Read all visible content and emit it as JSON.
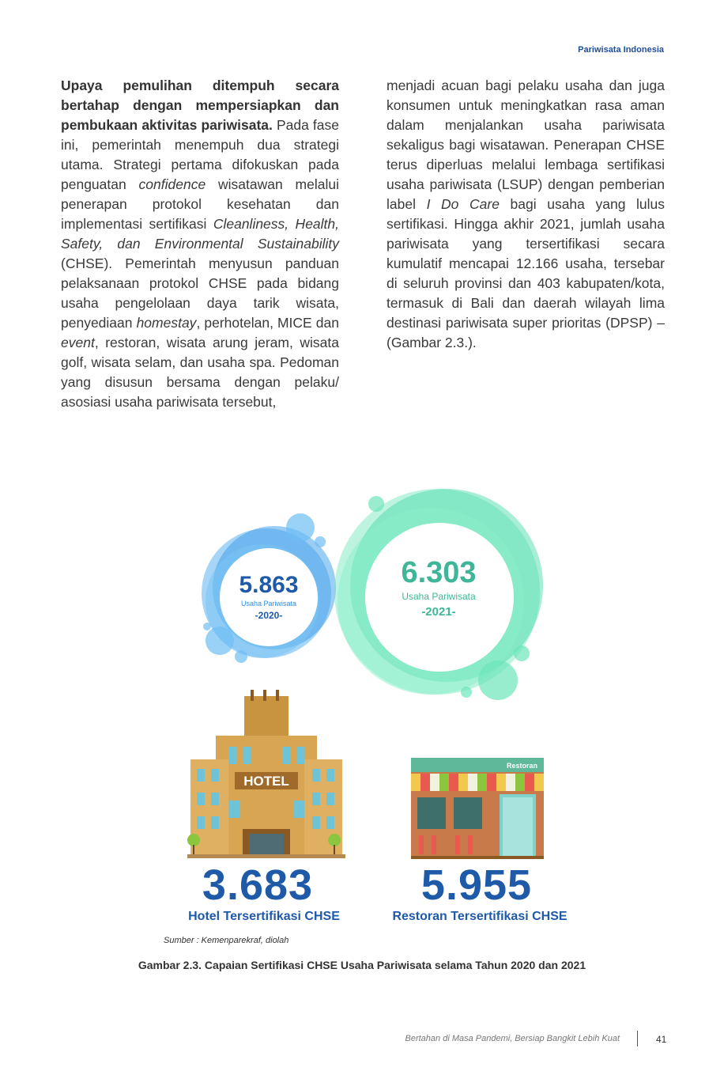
{
  "header": {
    "title": "Pariwisata Indonesia"
  },
  "body": {
    "left": {
      "bold_intro": "Upaya pemulihan ditempuh secara bertahap dengan mempersiapkan dan pembukaan aktivitas pariwisata.",
      "p1": " Pada fase ini, pemerintah menempuh dua strategi utama. Strategi pertama difokuskan pada penguatan ",
      "em_confidence": "confidence",
      "p2": " wisatawan melalui penerapan protokol kesehatan dan implementasi sertifikasi ",
      "em_chse": "Cleanliness, Health, Safety, dan Environmental Sustainability",
      "p3": " (CHSE). Pemerintah menyusun panduan pelaksanaan protokol CHSE pada bidang usaha pengelolaan daya tarik wisata, penyediaan ",
      "em_homestay": "homestay",
      "p4": ", perhotelan, MICE dan ",
      "em_event": "event",
      "p5": ", restoran, wisata arung jeram, wisata golf, wisata selam, dan usaha spa. Pedoman yang disusun bersama dengan pelaku/ asosiasi usaha pariwisata tersebut,"
    },
    "right": {
      "p1": "menjadi acuan bagi pelaku usaha dan juga konsumen untuk meningkatkan rasa aman dalam menjalankan usaha pariwisata sekaligus bagi wisatawan. Penerapan CHSE terus diperluas melalui lembaga sertifikasi usaha pariwisata (LSUP) dengan pemberian label ",
      "em_idocare": "I Do Care",
      "p2": " bagi usaha yang lulus sertifikasi. Hingga akhir 2021, jumlah usaha pariwisata yang tersertifikasi secara kumulatif mencapai 12.166 usaha, tersebar di seluruh provinsi dan 403 kabupaten/kota, termasuk di Bali dan daerah wilayah lima destinasi pariwisata super prioritas (DPSP) – (Gambar 2.3.)."
    }
  },
  "figure": {
    "bubble_2020": {
      "value": "5.863",
      "label": "Usaha Pariwisata",
      "year": "-2020-",
      "color": "#2e8fe0"
    },
    "bubble_2021": {
      "value": "6.303",
      "label": "Usaha Pariwisata",
      "year": "-2021-",
      "color": "#3fd6a4"
    },
    "hotel": {
      "sign": "HOTEL",
      "value": "3.683",
      "caption": "Hotel Tersertifikasi CHSE"
    },
    "restaurant": {
      "sign": "Restoran",
      "value": "5.955",
      "caption": "Restoran Tersertifikasi CHSE"
    },
    "source": "Sumber : Kemenparekraf, diolah",
    "caption": "Gambar 2.3. Capaian Sertifikasi CHSE Usaha Pariwisata selama Tahun 2020 dan 2021"
  },
  "footer": {
    "text": "Bertahan di Masa Pandemi, Bersiap Bangkit Lebih Kuat",
    "page": "41"
  }
}
